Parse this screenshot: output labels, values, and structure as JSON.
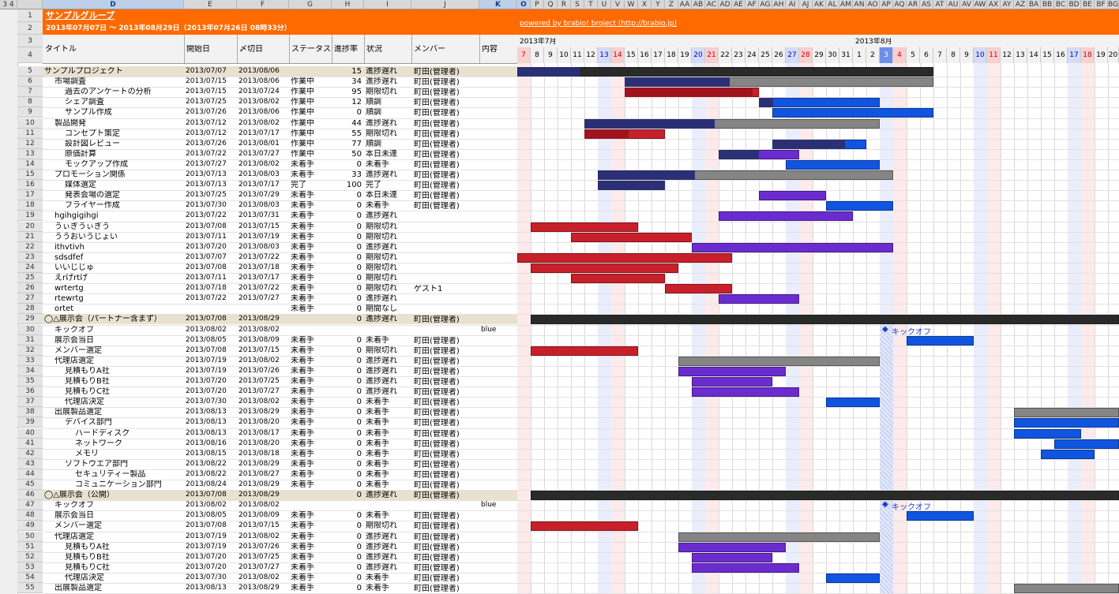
{
  "sheet": {
    "group_title": "サンプルグループ",
    "date_range": "2013年07月07日 〜 2013年08月29日（2013年07月26日 08時33分）",
    "powered_by": "powered by brabio! broject (http://brabio.jp)",
    "outline_levels": [
      "3",
      "4"
    ],
    "column_letters": [
      "D",
      "E",
      "F",
      "G",
      "H",
      "I",
      "J",
      "K",
      "O",
      "P",
      "Q",
      "R",
      "S",
      "T",
      "U",
      "V",
      "W",
      "X",
      "Y",
      "Z",
      "AA",
      "AB",
      "AC",
      "AD",
      "AE",
      "AF",
      "AG",
      "AH",
      "AI",
      "AJ",
      "AK",
      "AL",
      "AM",
      "AN",
      "AO",
      "AP",
      "AQ",
      "AR",
      "AS",
      "AT",
      "AU",
      "AV",
      "AW",
      "AX",
      "AY",
      "AZ",
      "BA",
      "BB",
      "BC",
      "BD",
      "BE",
      "BF",
      "BG"
    ]
  },
  "headers": {
    "title": "タイトル",
    "start": "開始日",
    "end": "〆切日",
    "status": "ステータス",
    "progress": "進捗率",
    "state": "状況",
    "member": "メンバー",
    "content": "内容"
  },
  "gantt": {
    "month1": "2013年7月",
    "month2": "2013年8月",
    "days": [
      "7",
      "8",
      "9",
      "10",
      "11",
      "12",
      "13",
      "14",
      "15",
      "16",
      "17",
      "18",
      "19",
      "20",
      "21",
      "22",
      "23",
      "24",
      "25",
      "26",
      "27",
      "28",
      "29",
      "30",
      "31",
      "1",
      "2",
      "3",
      "4",
      "5",
      "6",
      "7",
      "8",
      "9",
      "10",
      "11",
      "12",
      "13",
      "14",
      "15",
      "16",
      "17",
      "18",
      "19",
      "20"
    ]
  },
  "rows": [
    {
      "n": "5",
      "title": "サンプルプロジェクト",
      "indent": 0,
      "start": "2013/07/07",
      "end": "2013/08/06",
      "status": "",
      "progress": "15",
      "state": "進捗遅れ",
      "member": "町田(管理者)",
      "content": "",
      "group": true
    },
    {
      "n": "6",
      "title": "市場調査",
      "indent": 1,
      "start": "2013/07/15",
      "end": "2013/08/06",
      "status": "作業中",
      "progress": "34",
      "state": "進捗遅れ",
      "member": "町田(管理者)",
      "content": ""
    },
    {
      "n": "7",
      "title": "過去のアンケートの分析",
      "indent": 2,
      "start": "2013/07/15",
      "end": "2013/07/24",
      "status": "作業中",
      "progress": "95",
      "state": "期限切れ",
      "member": "町田(管理者)",
      "content": ""
    },
    {
      "n": "8",
      "title": "シェア調査",
      "indent": 2,
      "start": "2013/07/25",
      "end": "2013/08/02",
      "status": "作業中",
      "progress": "12",
      "state": "順調",
      "member": "町田(管理者)",
      "content": ""
    },
    {
      "n": "9",
      "title": "サンプル作成",
      "indent": 2,
      "start": "2013/07/26",
      "end": "2013/08/06",
      "status": "作業中",
      "progress": "0",
      "state": "順調",
      "member": "町田(管理者)",
      "content": ""
    },
    {
      "n": "10",
      "title": "製品開発",
      "indent": 1,
      "start": "2013/07/12",
      "end": "2013/08/02",
      "status": "作業中",
      "progress": "44",
      "state": "進捗遅れ",
      "member": "町田(管理者)",
      "content": ""
    },
    {
      "n": "11",
      "title": "コンセプト策定",
      "indent": 2,
      "start": "2013/07/12",
      "end": "2013/07/17",
      "status": "作業中",
      "progress": "55",
      "state": "期限切れ",
      "member": "町田(管理者)",
      "content": ""
    },
    {
      "n": "12",
      "title": "設計図レビュー",
      "indent": 2,
      "start": "2013/07/26",
      "end": "2013/08/01",
      "status": "作業中",
      "progress": "77",
      "state": "順調",
      "member": "町田(管理者)",
      "content": ""
    },
    {
      "n": "13",
      "title": "原価計算",
      "indent": 2,
      "start": "2013/07/22",
      "end": "2013/07/27",
      "status": "作業中",
      "progress": "50",
      "state": "本日未達",
      "member": "町田(管理者)",
      "content": ""
    },
    {
      "n": "14",
      "title": "モックアップ作成",
      "indent": 2,
      "start": "2013/07/27",
      "end": "2013/08/02",
      "status": "未着手",
      "progress": "0",
      "state": "未着手",
      "member": "町田(管理者)",
      "content": ""
    },
    {
      "n": "15",
      "title": "プロモーション関係",
      "indent": 1,
      "start": "2013/07/13",
      "end": "2013/08/03",
      "status": "未着手",
      "progress": "33",
      "state": "進捗遅れ",
      "member": "町田(管理者)",
      "content": ""
    },
    {
      "n": "16",
      "title": "媒体選定",
      "indent": 2,
      "start": "2013/07/13",
      "end": "2013/07/17",
      "status": "完了",
      "progress": "100",
      "state": "完了",
      "member": "町田(管理者)",
      "content": ""
    },
    {
      "n": "17",
      "title": "発表会場の選定",
      "indent": 2,
      "start": "2013/07/25",
      "end": "2013/07/29",
      "status": "未着手",
      "progress": "0",
      "state": "本日未達",
      "member": "町田(管理者)",
      "content": ""
    },
    {
      "n": "18",
      "title": "フライヤー作成",
      "indent": 2,
      "start": "2013/07/30",
      "end": "2013/08/03",
      "status": "未着手",
      "progress": "0",
      "state": "未着手",
      "member": "町田(管理者)",
      "content": ""
    },
    {
      "n": "19",
      "title": "hgihgigihgi",
      "indent": 1,
      "start": "2013/07/22",
      "end": "2013/07/31",
      "status": "未着手",
      "progress": "0",
      "state": "進捗遅れ",
      "member": "",
      "content": ""
    },
    {
      "n": "20",
      "title": "うぃぎうぃぎう",
      "indent": 1,
      "start": "2013/07/08",
      "end": "2013/07/15",
      "status": "未着手",
      "progress": "0",
      "state": "期限切れ",
      "member": "",
      "content": ""
    },
    {
      "n": "21",
      "title": "ううおいうじょい",
      "indent": 1,
      "start": "2013/07/11",
      "end": "2013/07/19",
      "status": "未着手",
      "progress": "0",
      "state": "期限切れ",
      "member": "",
      "content": ""
    },
    {
      "n": "22",
      "title": "ithvtivh",
      "indent": 1,
      "start": "2013/07/20",
      "end": "2013/08/03",
      "status": "未着手",
      "progress": "0",
      "state": "進捗遅れ",
      "member": "",
      "content": ""
    },
    {
      "n": "23",
      "title": "sdsdfef",
      "indent": 1,
      "start": "2013/07/07",
      "end": "2013/07/22",
      "status": "未着手",
      "progress": "0",
      "state": "期限切れ",
      "member": "",
      "content": ""
    },
    {
      "n": "24",
      "title": "いいじじゅ",
      "indent": 1,
      "start": "2013/07/08",
      "end": "2013/07/18",
      "status": "未着手",
      "progress": "0",
      "state": "期限切れ",
      "member": "",
      "content": ""
    },
    {
      "n": "25",
      "title": "えrげrtげ",
      "indent": 1,
      "start": "2013/07/11",
      "end": "2013/07/17",
      "status": "未着手",
      "progress": "0",
      "state": "期限切れ",
      "member": "",
      "content": ""
    },
    {
      "n": "26",
      "title": "wrtertg",
      "indent": 1,
      "start": "2013/07/18",
      "end": "2013/07/22",
      "status": "未着手",
      "progress": "0",
      "state": "期限切れ",
      "member": "ゲスト1",
      "content": ""
    },
    {
      "n": "27",
      "title": "rtewrtg",
      "indent": 1,
      "start": "2013/07/22",
      "end": "2013/07/27",
      "status": "未着手",
      "progress": "0",
      "state": "進捗遅れ",
      "member": "",
      "content": ""
    },
    {
      "n": "28",
      "title": "ortet",
      "indent": 1,
      "start": "",
      "end": "",
      "status": "未着手",
      "progress": "0",
      "state": "期間なし",
      "member": "",
      "content": ""
    },
    {
      "n": "29",
      "title": "◯△展示会（パートナー含まず）",
      "indent": 0,
      "start": "2013/07/08",
      "end": "2013/08/29",
      "status": "",
      "progress": "0",
      "state": "進捗遅れ",
      "member": "町田(管理者)",
      "content": "",
      "group": true
    },
    {
      "n": "30",
      "title": "キックオフ",
      "indent": 1,
      "start": "2013/08/02",
      "end": "2013/08/02",
      "status": "",
      "progress": "",
      "state": "",
      "member": "",
      "content": "blue"
    },
    {
      "n": "31",
      "title": "展示会当日",
      "indent": 1,
      "start": "2013/08/05",
      "end": "2013/08/09",
      "status": "未着手",
      "progress": "0",
      "state": "未着手",
      "member": "町田(管理者)",
      "content": ""
    },
    {
      "n": "32",
      "title": "メンバー選定",
      "indent": 1,
      "start": "2013/07/08",
      "end": "2013/07/15",
      "status": "未着手",
      "progress": "0",
      "state": "期限切れ",
      "member": "町田(管理者)",
      "content": ""
    },
    {
      "n": "33",
      "title": "代理店選定",
      "indent": 1,
      "start": "2013/07/19",
      "end": "2013/08/02",
      "status": "未着手",
      "progress": "0",
      "state": "進捗遅れ",
      "member": "町田(管理者)",
      "content": ""
    },
    {
      "n": "34",
      "title": "見積もりA社",
      "indent": 2,
      "start": "2013/07/19",
      "end": "2013/07/26",
      "status": "未着手",
      "progress": "0",
      "state": "進捗遅れ",
      "member": "町田(管理者)",
      "content": ""
    },
    {
      "n": "35",
      "title": "見積もりB社",
      "indent": 2,
      "start": "2013/07/20",
      "end": "2013/07/25",
      "status": "未着手",
      "progress": "0",
      "state": "進捗遅れ",
      "member": "町田(管理者)",
      "content": ""
    },
    {
      "n": "36",
      "title": "見積もりC社",
      "indent": 2,
      "start": "2013/07/20",
      "end": "2013/07/27",
      "status": "未着手",
      "progress": "0",
      "state": "進捗遅れ",
      "member": "町田(管理者)",
      "content": ""
    },
    {
      "n": "37",
      "title": "代理店決定",
      "indent": 2,
      "start": "2013/07/30",
      "end": "2013/08/02",
      "status": "未着手",
      "progress": "0",
      "state": "未着手",
      "member": "町田(管理者)",
      "content": ""
    },
    {
      "n": "38",
      "title": "出展製品選定",
      "indent": 1,
      "start": "2013/08/13",
      "end": "2013/08/29",
      "status": "未着手",
      "progress": "0",
      "state": "未着手",
      "member": "町田(管理者)",
      "content": ""
    },
    {
      "n": "39",
      "title": "デバイス部門",
      "indent": 2,
      "start": "2013/08/13",
      "end": "2013/08/20",
      "status": "未着手",
      "progress": "0",
      "state": "未着手",
      "member": "町田(管理者)",
      "content": ""
    },
    {
      "n": "40",
      "title": "ハードディスク",
      "indent": 3,
      "start": "2013/08/13",
      "end": "2013/08/17",
      "status": "未着手",
      "progress": "0",
      "state": "未着手",
      "member": "町田(管理者)",
      "content": ""
    },
    {
      "n": "41",
      "title": "ネットワーク",
      "indent": 3,
      "start": "2013/08/16",
      "end": "2013/08/20",
      "status": "未着手",
      "progress": "0",
      "state": "未着手",
      "member": "町田(管理者)",
      "content": ""
    },
    {
      "n": "42",
      "title": "メモリ",
      "indent": 3,
      "start": "2013/08/15",
      "end": "2013/08/18",
      "status": "未着手",
      "progress": "0",
      "state": "未着手",
      "member": "町田(管理者)",
      "content": ""
    },
    {
      "n": "43",
      "title": "ソフトウエア部門",
      "indent": 2,
      "start": "2013/08/22",
      "end": "2013/08/29",
      "status": "未着手",
      "progress": "0",
      "state": "未着手",
      "member": "町田(管理者)",
      "content": ""
    },
    {
      "n": "44",
      "title": "セキュリティー製品",
      "indent": 3,
      "start": "2013/08/22",
      "end": "2013/08/27",
      "status": "未着手",
      "progress": "0",
      "state": "未着手",
      "member": "町田(管理者)",
      "content": ""
    },
    {
      "n": "45",
      "title": "コミュニケーション部門",
      "indent": 3,
      "start": "2013/08/24",
      "end": "2013/08/29",
      "status": "未着手",
      "progress": "0",
      "state": "未着手",
      "member": "町田(管理者)",
      "content": ""
    },
    {
      "n": "46",
      "title": "◯△展示会（公開）",
      "indent": 0,
      "start": "2013/07/08",
      "end": "2013/08/29",
      "status": "",
      "progress": "0",
      "state": "進捗遅れ",
      "member": "町田(管理者)",
      "content": "",
      "group": true
    },
    {
      "n": "47",
      "title": "キックオフ",
      "indent": 1,
      "start": "2013/08/02",
      "end": "2013/08/02",
      "status": "",
      "progress": "",
      "state": "",
      "member": "",
      "content": "blue"
    },
    {
      "n": "48",
      "title": "展示会当日",
      "indent": 1,
      "start": "2013/08/05",
      "end": "2013/08/09",
      "status": "未着手",
      "progress": "0",
      "state": "未着手",
      "member": "町田(管理者)",
      "content": ""
    },
    {
      "n": "49",
      "title": "メンバー選定",
      "indent": 1,
      "start": "2013/07/08",
      "end": "2013/07/15",
      "status": "未着手",
      "progress": "0",
      "state": "期限切れ",
      "member": "町田(管理者)",
      "content": ""
    },
    {
      "n": "50",
      "title": "代理店選定",
      "indent": 1,
      "start": "2013/07/19",
      "end": "2013/08/02",
      "status": "未着手",
      "progress": "0",
      "state": "進捗遅れ",
      "member": "町田(管理者)",
      "content": ""
    },
    {
      "n": "51",
      "title": "見積もりA社",
      "indent": 2,
      "start": "2013/07/19",
      "end": "2013/07/26",
      "status": "未着手",
      "progress": "0",
      "state": "進捗遅れ",
      "member": "町田(管理者)",
      "content": ""
    },
    {
      "n": "52",
      "title": "見積もりB社",
      "indent": 2,
      "start": "2013/07/20",
      "end": "2013/07/25",
      "status": "未着手",
      "progress": "0",
      "state": "進捗遅れ",
      "member": "町田(管理者)",
      "content": ""
    },
    {
      "n": "53",
      "title": "見積もりC社",
      "indent": 2,
      "start": "2013/07/20",
      "end": "2013/07/27",
      "status": "未着手",
      "progress": "0",
      "state": "進捗遅れ",
      "member": "町田(管理者)",
      "content": ""
    },
    {
      "n": "54",
      "title": "代理店決定",
      "indent": 2,
      "start": "2013/07/30",
      "end": "2013/08/02",
      "status": "未着手",
      "progress": "0",
      "state": "未着手",
      "member": "町田(管理者)",
      "content": ""
    },
    {
      "n": "55",
      "title": "出展製品選定",
      "indent": 1,
      "start": "2013/08/13",
      "end": "2013/08/29",
      "status": "未着手",
      "progress": "0",
      "state": "未着手",
      "member": "町田(管理者)",
      "content": ""
    }
  ],
  "milestones": [
    {
      "row": "30",
      "label": "キックオフ"
    },
    {
      "row": "47",
      "label": "キックオフ"
    }
  ],
  "colors": {
    "band": "#ff6a00",
    "group_row": "#e8e1cf",
    "late_red": "#c8202a",
    "navy": "#2b2f74",
    "gray": "#858585",
    "blue": "#1055e0",
    "purple": "#6a2ccf",
    "black": "#2a2a2a"
  }
}
